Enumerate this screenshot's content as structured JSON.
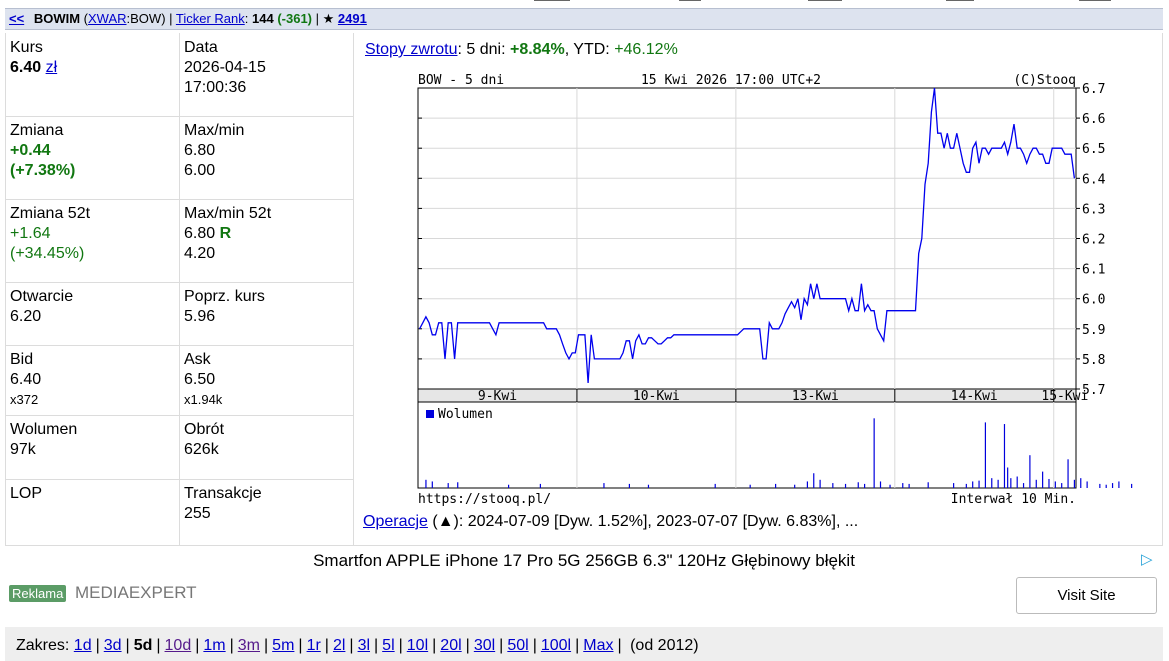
{
  "header": {
    "back": "<<",
    "symbol": "BOWIM",
    "exchange": "XWAR",
    "exchange_code": ":BOW",
    "ticker_rank_label": "Ticker Rank",
    "ticker_rank_value": "144",
    "ticker_rank_change": "(-361)",
    "star": "★",
    "star_count": "2491"
  },
  "quote": {
    "kurs_label": "Kurs",
    "kurs_value": "6.40",
    "kurs_currency": "zł",
    "data_label": "Data",
    "data_date": "2026-04-15",
    "data_time": "17:00:36",
    "zmiana_label": "Zmiana",
    "zmiana_value": "+0.44",
    "zmiana_pct": "(+7.38%)",
    "maxmin_label": "Max/min",
    "max": "6.80",
    "min": "6.00",
    "zmiana52_label": "Zmiana 52t",
    "zmiana52_value": "+1.64",
    "zmiana52_pct": "(+34.45%)",
    "maxmin52_label": "Max/min 52t",
    "max52": "6.80",
    "max52_flag": "R",
    "min52": "4.20",
    "otwarcie_label": "Otwarcie",
    "otwarcie": "6.20",
    "poprz_label": "Poprz. kurs",
    "poprz": "5.96",
    "bid_label": "Bid",
    "bid": "6.40",
    "bid_size": "x372",
    "ask_label": "Ask",
    "ask": "6.50",
    "ask_size": "x1.94k",
    "wolumen_label": "Wolumen",
    "wolumen": "97k",
    "obrot_label": "Obrót",
    "obrot": "626k",
    "lop_label": "LOP",
    "transakcje_label": "Transakcje",
    "transakcje": "255"
  },
  "returns": {
    "link": "Stopy zwrotu",
    "d5_label": ": 5 dni: ",
    "d5": "+8.84%",
    "ytd_label": ", YTD: ",
    "ytd": "+46.12%"
  },
  "chart_data": {
    "type": "line",
    "title_left": "BOW - 5 dni",
    "title_center": "15 Kwi 2026 17:00 UTC+2",
    "title_right": "(C)Stooq",
    "footer_left": "https://stooq.pl/",
    "footer_right": "Interwał 10 Min.",
    "volume_legend": "Wolumen",
    "ylim": [
      5.7,
      6.7
    ],
    "yticks": [
      "6.7",
      "6.6",
      "6.5",
      "6.4",
      "6.3",
      "6.2",
      "6.1",
      "6.0",
      "5.9",
      "5.8",
      "5.7"
    ],
    "days": [
      "9-Kwi",
      "10-Kwi",
      "13-Kwi",
      "14-Kwi",
      "15-Kwi"
    ],
    "points_per_day": 50,
    "price": [
      5.9,
      5.92,
      5.94,
      5.92,
      5.88,
      5.88,
      5.92,
      5.92,
      5.8,
      5.92,
      5.92,
      5.8,
      5.92,
      5.92,
      5.92,
      5.92,
      5.92,
      5.92,
      5.92,
      5.92,
      5.92,
      5.92,
      5.92,
      5.9,
      5.88,
      5.92,
      5.92,
      5.92,
      5.92,
      5.92,
      5.92,
      5.92,
      5.92,
      5.92,
      5.92,
      5.92,
      5.92,
      5.92,
      5.92,
      5.92,
      5.9,
      5.9,
      5.9,
      5.9,
      5.88,
      5.85,
      5.82,
      5.8,
      5.82,
      5.82,
      5.88,
      5.88,
      5.88,
      5.72,
      5.88,
      5.8,
      5.8,
      5.8,
      5.8,
      5.8,
      5.8,
      5.8,
      5.8,
      5.8,
      5.82,
      5.86,
      5.86,
      5.8,
      5.86,
      5.88,
      5.85,
      5.85,
      5.87,
      5.87,
      5.86,
      5.85,
      5.85,
      5.86,
      5.87,
      5.87,
      5.88,
      5.88,
      5.88,
      5.88,
      5.88,
      5.88,
      5.88,
      5.88,
      5.88,
      5.88,
      5.88,
      5.88,
      5.88,
      5.88,
      5.88,
      5.88,
      5.88,
      5.88,
      5.88,
      5.88,
      5.88,
      5.89,
      5.9,
      5.9,
      5.9,
      5.9,
      5.9,
      5.9,
      5.8,
      5.8,
      5.92,
      5.9,
      5.9,
      5.9,
      5.92,
      5.95,
      5.97,
      5.99,
      5.97,
      6.0,
      5.93,
      6.0,
      5.98,
      6.05,
      6.0,
      6.05,
      6.0,
      6.0,
      6.0,
      6.0,
      6.0,
      6.0,
      6.0,
      6.0,
      6.0,
      5.96,
      6.0,
      5.96,
      5.96,
      6.05,
      5.96,
      5.98,
      5.96,
      5.96,
      5.9,
      5.88,
      5.86,
      5.96,
      5.96,
      5.96,
      5.96,
      5.96,
      5.96,
      5.96,
      5.96,
      5.96,
      5.96,
      6.15,
      6.2,
      6.38,
      6.45,
      6.62,
      6.7,
      6.55,
      6.55,
      6.5,
      6.55,
      6.5,
      6.5,
      6.55,
      6.5,
      6.45,
      6.42,
      6.42,
      6.5,
      6.52,
      6.45,
      6.5,
      6.5,
      6.48,
      6.5,
      6.5,
      6.5,
      6.5,
      6.52,
      6.48,
      6.52,
      6.58,
      6.5,
      6.5,
      6.48,
      6.45,
      6.48,
      6.5,
      6.5,
      6.48,
      6.48,
      6.45,
      6.45,
      6.5,
      6.5,
      6.5,
      6.5,
      6.48,
      6.48,
      6.48,
      6.4
    ],
    "volume_spikes": [
      [
        2,
        10
      ],
      [
        4,
        8
      ],
      [
        9,
        6
      ],
      [
        12,
        7
      ],
      [
        28,
        4
      ],
      [
        38,
        5
      ],
      [
        58,
        6
      ],
      [
        66,
        5
      ],
      [
        72,
        4
      ],
      [
        93,
        5
      ],
      [
        104,
        4
      ],
      [
        112,
        5
      ],
      [
        118,
        4
      ],
      [
        122,
        8
      ],
      [
        124,
        18
      ],
      [
        126,
        10
      ],
      [
        130,
        6
      ],
      [
        134,
        5
      ],
      [
        138,
        7
      ],
      [
        140,
        5
      ],
      [
        143,
        85
      ],
      [
        145,
        8
      ],
      [
        148,
        4
      ],
      [
        152,
        6
      ],
      [
        154,
        5
      ],
      [
        160,
        7
      ],
      [
        168,
        6
      ],
      [
        172,
        5
      ],
      [
        174,
        8
      ],
      [
        176,
        9
      ],
      [
        178,
        80
      ],
      [
        180,
        12
      ],
      [
        182,
        10
      ],
      [
        184,
        78
      ],
      [
        185,
        25
      ],
      [
        186,
        12
      ],
      [
        188,
        14
      ],
      [
        190,
        6
      ],
      [
        192,
        40
      ],
      [
        194,
        10
      ],
      [
        196,
        20
      ],
      [
        198,
        11
      ],
      [
        200,
        8
      ],
      [
        202,
        6
      ],
      [
        204,
        35
      ],
      [
        206,
        10
      ],
      [
        208,
        12
      ],
      [
        210,
        8
      ],
      [
        214,
        5
      ],
      [
        216,
        4
      ],
      [
        218,
        6
      ],
      [
        220,
        8
      ],
      [
        224,
        5
      ],
      [
        226,
        12
      ],
      [
        229,
        14
      ]
    ]
  },
  "operations": {
    "link": "Operacje",
    "text": " (▲): 2024-07-09 [Dyw. 1.52%], 2023-07-07 [Dyw. 6.83%], ..."
  },
  "ad": {
    "title": "Smartfon APPLE iPhone 17 Pro 5G 256GB 6.3\" 120Hz Głębinowy błękit",
    "badge": "Reklama",
    "brand": "MEDIAEXPERT",
    "button": "Visit Site",
    "triangle": "▷"
  },
  "range": {
    "label": "Zakres:",
    "items": [
      {
        "t": "1d",
        "k": "link"
      },
      {
        "t": "3d",
        "k": "link"
      },
      {
        "t": "5d",
        "k": "current"
      },
      {
        "t": "10d",
        "k": "visited"
      },
      {
        "t": "1m",
        "k": "link"
      },
      {
        "t": "3m",
        "k": "visited"
      },
      {
        "t": "5m",
        "k": "link"
      },
      {
        "t": "1r",
        "k": "link"
      },
      {
        "t": "2l",
        "k": "link"
      },
      {
        "t": "3l",
        "k": "link"
      },
      {
        "t": "5l",
        "k": "link"
      },
      {
        "t": "10l",
        "k": "link"
      },
      {
        "t": "20l",
        "k": "link"
      },
      {
        "t": "30l",
        "k": "link"
      },
      {
        "t": "50l",
        "k": "link"
      },
      {
        "t": "100l",
        "k": "link"
      },
      {
        "t": "Max",
        "k": "link"
      }
    ],
    "suffix": "(od 2012)"
  },
  "colors": {
    "price_line": "#0000ee",
    "header_bg": "#dde3ef",
    "positive": "#117711",
    "link": "#0000cc"
  }
}
